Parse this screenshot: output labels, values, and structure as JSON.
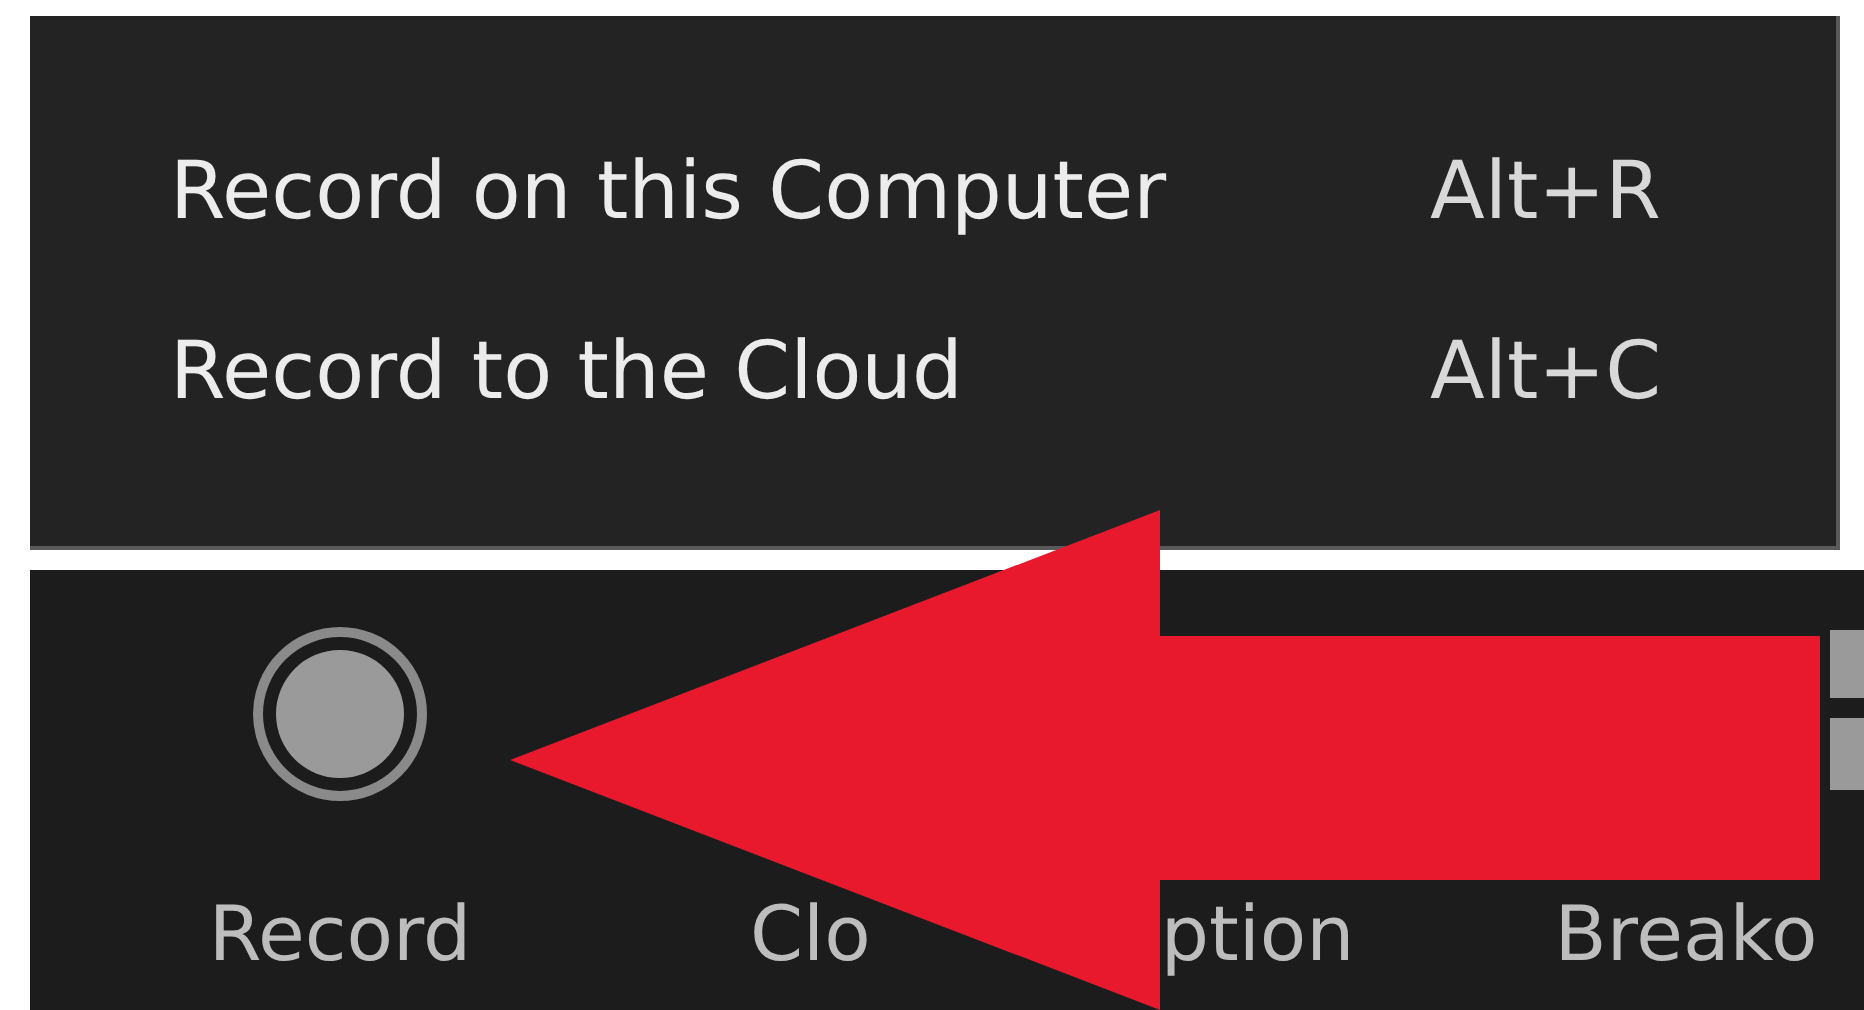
{
  "menu": {
    "items": [
      {
        "label": "Record on this Computer",
        "shortcut": "Alt+R"
      },
      {
        "label": "Record to the Cloud",
        "shortcut": "Alt+C"
      }
    ]
  },
  "toolbar": {
    "buttons": [
      {
        "kind": "record",
        "labels": [
          "Record"
        ]
      },
      {
        "kind": "text",
        "labels": [
          "Clo",
          "ption"
        ]
      },
      {
        "kind": "grid",
        "labels": [
          "Breako"
        ]
      }
    ]
  },
  "annotation": {
    "kind": "arrow"
  }
}
